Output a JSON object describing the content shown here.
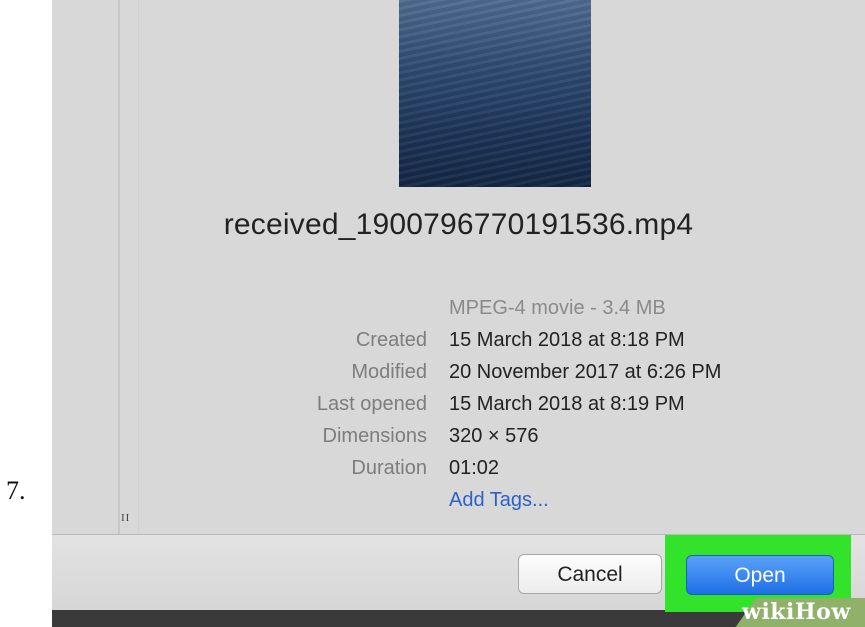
{
  "step": {
    "number": "7."
  },
  "file": {
    "name": "received_1900796770191536.mp4",
    "kind_size": "MPEG-4 movie - 3.4 MB"
  },
  "info": [
    {
      "label": "Created",
      "value": "15 March 2018 at 8:18 PM"
    },
    {
      "label": "Modified",
      "value": "20 November 2017 at 6:26 PM"
    },
    {
      "label": "Last opened",
      "value": "15 March 2018 at 8:19 PM"
    },
    {
      "label": "Dimensions",
      "value": "320 × 576"
    },
    {
      "label": "Duration",
      "value": "01:02"
    }
  ],
  "tags": {
    "add_label": "Add Tags..."
  },
  "buttons": {
    "cancel": "Cancel",
    "open": "Open"
  },
  "watermark": {
    "text": "wikiHow"
  },
  "colors": {
    "highlight": "#33e22b",
    "primary_button": "#1f6fe6",
    "link": "#2a62c9"
  }
}
